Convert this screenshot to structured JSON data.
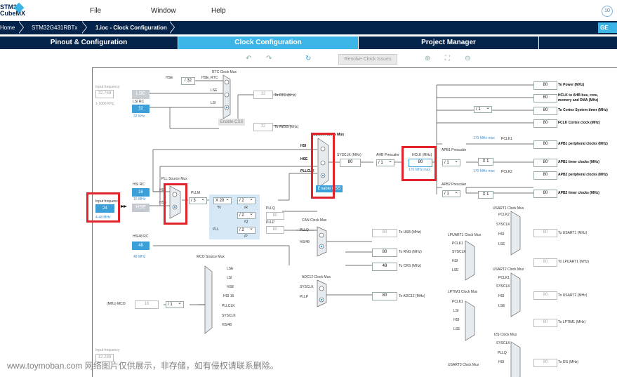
{
  "app": {
    "logo_line1": "STM32",
    "logo_line2": "CubeMX"
  },
  "menu": {
    "file": "File",
    "window": "Window",
    "help": "Help"
  },
  "breadcrumb": {
    "home": "Home",
    "device": "STM32G431RBTx",
    "current": "1.ioc - Clock Configuration",
    "generate": "GE"
  },
  "tabs": {
    "pinout": "Pinout & Configuration",
    "clock": "Clock Configuration",
    "project": "Project Manager"
  },
  "toolbar": {
    "resolve": "Resolve Clock Issues"
  },
  "diagram": {
    "input_freq_label": "Input frequency",
    "lse_input": "32.768",
    "lse_range": "1-1000 KHz",
    "lse": "LSE",
    "lsi_rc": "LSI RC",
    "lsi_val": "32",
    "lsi_khz": "32 KHz",
    "hsi_rc": "HSI RC",
    "hsi_val": "16",
    "hsi_mhz": "16 MHz",
    "hse": "HSE",
    "hse_input": "24",
    "hse_range": "4-48 MHz",
    "hsi48_rc": "HSI48 RC",
    "hsi48_val": "48",
    "hsi48_mhz": "48 MHz",
    "lower_input": "12.288",
    "rtc_mux": "RTC Clock Mux",
    "rtc_hse": "HSE",
    "rtc_div": "/ 32",
    "rtc_hse_rtc": "HSE_RTC",
    "rtc_lse": "LSE",
    "rtc_lsi": "LSI",
    "rtc_val": "32",
    "rtc_to": "To RTC (KHz)",
    "enable_css": "Enable CSS",
    "iwdg_val": "32",
    "iwdg_to": "To IWDG (KHz)",
    "sys_mux": "System Clock Mux",
    "sys_hsi": "HSI",
    "sys_hse": "HSE",
    "sys_pll": "PLLCLK",
    "sysclk_label": "SYSCLK (MHz)",
    "sysclk_val": "80",
    "ahb_label": "AHB Prescaler",
    "ahb_sel": "/ 1",
    "hclk_label": "HCLK (MHz)",
    "hclk_val": "80",
    "hclk_max": "170 MHz max",
    "enable_css2": "Enable CSS",
    "pll_src_mux": "PLL Source Mux",
    "pll_hsi": "HSI",
    "pll_hse": "HSE",
    "pllm_label": "PLLM",
    "pllm_sel": "/ 3",
    "plln_sel": "X 20",
    "plln_label": "*N",
    "pllr_sel": "/ 2",
    "pllr_label": "/R",
    "pllq_sel": "/ 2",
    "pllq_label": "/Q",
    "pllp_sel": "/ 2",
    "pllp_label": "/P",
    "pll_label": "PLL",
    "pllq_out": "PLLQ",
    "pllq_out_val": "80",
    "pllp_out": "PLLP",
    "pllp_out_val": "80",
    "can_mux": "CAN Clock Mux",
    "can_pllq": "PLLQ",
    "can_hsi48": "HSI48",
    "usb_val": "80",
    "usb_to": "To USB (MHz)",
    "rng_val": "80",
    "rng_to": "To RNG (MHz)",
    "crs_val": "48",
    "crs_to": "To CRS (MHz)",
    "adc_mux": "ADC12 Clock Mux",
    "adc_sysclk": "SYSCLK",
    "adc_pllp": "PLLP",
    "adc_val": "80",
    "adc_to": "To ADC12 (MHz)",
    "mco_mux": "MCO Source Mux",
    "mco_opts": [
      "LSE",
      "LSI",
      "HSE",
      "HSI 16",
      "PLLCLK",
      "SYSCLK",
      "HSI48"
    ],
    "mco_label": "(MHz) MCO",
    "mco_val": "16",
    "mco_div": "/ 1",
    "cortex_div": "/ 1",
    "apb1_label": "APB1 Prescaler",
    "apb1_sel": "/ 1",
    "apb1_max": "170 MHz max",
    "pclk1": "PCLK1",
    "apb1_x": "X 1",
    "apb2_label": "APB2 Prescaler",
    "apb2_sel": "/ 1",
    "apb2_max": "170 MHz max",
    "pclk2": "PCLK2",
    "apb2_x": "X 1",
    "outputs": [
      {
        "val": "80",
        "label": "To Power (MHz)"
      },
      {
        "val": "80",
        "label": "HCLK to AHB bus, core,"
      },
      {
        "val": "80",
        "label": "To Cortex System timer (MHz)"
      },
      {
        "val": "80",
        "label": "FCLK Cortex clock (MHz)"
      },
      {
        "val": "80",
        "label": "APB1 peripheral clocks (MHz)"
      },
      {
        "val": "80",
        "label": "APB1 timer clocks (MHz)"
      },
      {
        "val": "80",
        "label": "APB2 peripheral clocks (MHz)"
      },
      {
        "val": "80",
        "label": "APB2 timer clocks (MHz)"
      }
    ],
    "hclk_sub": "memory and DMA (MHz)",
    "usart1_mux": "USART1 Clock Mux",
    "usart1_opts": [
      "PCLK2",
      "SYSCLK",
      "HSI",
      "LSE"
    ],
    "usart1_val": "80",
    "usart1_to": "To USART1 (MHz)",
    "lpuart_mux": "LPUART1 Clock Mux",
    "lpuart_opts": [
      "PCLK1",
      "SYSCLK",
      "HSI",
      "LSE"
    ],
    "lpuart_val": "80",
    "lpuart_to": "To LPUART1 (MHz)",
    "usart2_mux": "USART2 Clock Mux",
    "usart2_opts": [
      "PCLK1",
      "SYSCLK",
      "HSI",
      "LSE"
    ],
    "usart2_val": "80",
    "usart2_to": "To USART2 (MHz)",
    "lptim_mux": "LPTIM1 Clock Mux",
    "lptim_opts": [
      "PCLK1",
      "LSI",
      "HSI",
      "LSE"
    ],
    "lptim_val": "80",
    "lptim_to": "To LPTIM1 (MHz)",
    "i2s_mux": "I2S Clock Mux",
    "i2s_opts": [
      "SYSCLK",
      "PLLQ",
      "HSI"
    ],
    "i2s_val": "80",
    "i2s_to": "To I2S (MHz)",
    "usart3_mux": "USART3 Clock Mux"
  },
  "watermark": "www.toymoban.com 网络图片仅供展示，非存储，如有侵权请联系删除。"
}
